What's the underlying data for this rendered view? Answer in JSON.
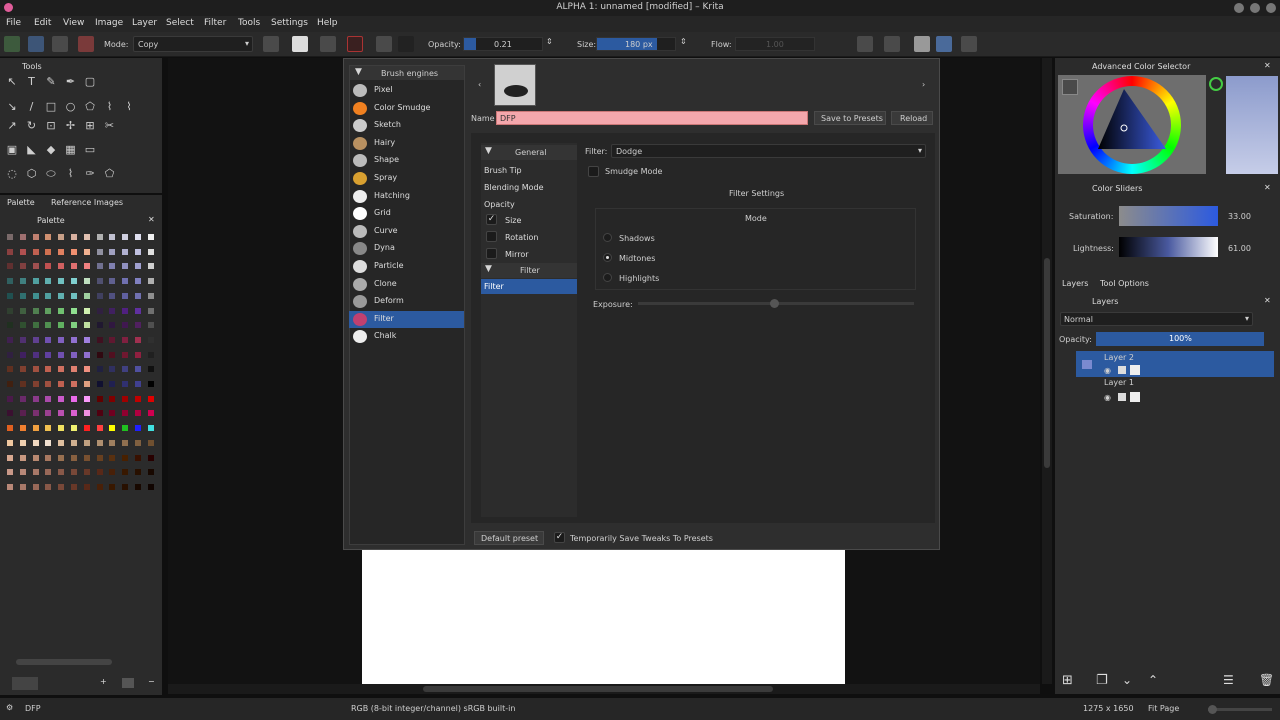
{
  "window": {
    "title": "ALPHA 1: unnamed [modified] – Krita"
  },
  "menu": [
    "File",
    "Edit",
    "View",
    "Image",
    "Layer",
    "Select",
    "Filter",
    "Tools",
    "Settings",
    "Help"
  ],
  "toolbar": {
    "mode_label": "Mode:",
    "mode_value": "Copy",
    "opacity_label": "Opacity:",
    "opacity_value": "0.21",
    "size_label": "Size:",
    "size_value": "180 px",
    "flow_label": "Flow:",
    "flow_value": "1.00"
  },
  "tools_docker": {
    "title": "Tools"
  },
  "palette_docker": {
    "tabs": [
      "Palette",
      "Reference Images"
    ],
    "title": "Palette"
  },
  "brush_editor": {
    "engines_header": "Brush engines",
    "engines": [
      "Pixel",
      "Color Smudge",
      "Sketch",
      "Hairy",
      "Shape",
      "Spray",
      "Hatching",
      "Grid",
      "Curve",
      "Dyna",
      "Particle",
      "Clone",
      "Deform",
      "Filter",
      "Chalk"
    ],
    "selected_engine": "Filter",
    "name_label": "Name",
    "name_value": "DFP",
    "save_button": "Save to Presets",
    "reload_button": "Reload",
    "general_header": "General",
    "options": [
      "Brush Tip",
      "Blending Mode",
      "Opacity",
      "Size",
      "Rotation",
      "Mirror"
    ],
    "filter_header": "Filter",
    "filter_option": "Filter",
    "filter_label": "Filter:",
    "filter_value": "Dodge",
    "smudge_mode": "Smudge Mode",
    "filter_settings": "Filter Settings",
    "mode_header": "Mode",
    "modes": [
      "Shadows",
      "Midtones",
      "Highlights"
    ],
    "selected_mode": "Midtones",
    "exposure_label": "Exposure:",
    "default_preset": "Default preset",
    "temp_save": "Temporarily Save Tweaks To Presets"
  },
  "color_selector": {
    "title": "Advanced Color Selector"
  },
  "color_sliders": {
    "title": "Color Sliders",
    "saturation_label": "Saturation:",
    "saturation_value": "33.00",
    "lightness_label": "Lightness:",
    "lightness_value": "61.00"
  },
  "layers": {
    "tabs": [
      "Layers",
      "Tool Options"
    ],
    "title": "Layers",
    "blend_mode": "Normal",
    "opacity_label": "Opacity:",
    "opacity_value": "100%",
    "items": [
      "Layer 2",
      "Layer 1"
    ]
  },
  "status": {
    "preset": "DFP",
    "color_space": "RGB (8-bit integer/channel)  sRGB built-in",
    "dimensions": "1275 x 1650",
    "zoom": "Fit Page"
  },
  "colors": {
    "accent": "#2c5aa0",
    "name_field": "#f4a7ac"
  }
}
